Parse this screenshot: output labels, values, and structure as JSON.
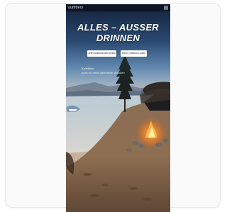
{
  "app": {
    "brand": "outfittery"
  },
  "hero": {
    "headline_line1": "ALLES – AUSSER",
    "headline_line2": "DRINNEN",
    "primary_button": "Jetzt Outdoorlook finden",
    "secondary_button": "Mehr Outdoor-Looks",
    "info_title": "Kollektion",
    "info_subtitle": "Alles für deine Abenteuer draußen"
  },
  "colors": {
    "sky_top": "#1a2e4f",
    "sky_mid": "#6a92b6",
    "horizon": "#c9a993",
    "lake": "#a9c3d1",
    "sand": "#9b7a5c",
    "fire": "#ff9a3a"
  },
  "icons": {
    "menu": "hamburger-icon",
    "tree": "pine-tree",
    "fire": "campfire"
  }
}
